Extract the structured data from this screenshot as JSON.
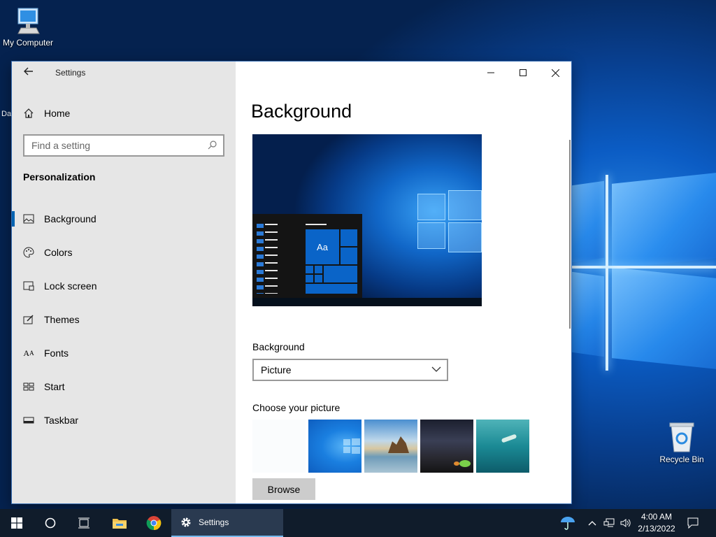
{
  "desktop": {
    "icons": [
      {
        "label": "My Computer"
      },
      {
        "label": "Recycle Bin"
      }
    ],
    "partial_label": "Da"
  },
  "window": {
    "title": "Settings",
    "nav": {
      "home_label": "Home",
      "search_placeholder": "Find a setting",
      "section_label": "Personalization",
      "items": [
        {
          "label": "Background",
          "icon": "picture-icon",
          "active": true
        },
        {
          "label": "Colors",
          "icon": "palette-icon",
          "active": false
        },
        {
          "label": "Lock screen",
          "icon": "lock-screen-icon",
          "active": false
        },
        {
          "label": "Themes",
          "icon": "themes-icon",
          "active": false
        },
        {
          "label": "Fonts",
          "icon": "fonts-icon",
          "active": false
        },
        {
          "label": "Start",
          "icon": "start-icon",
          "active": false
        },
        {
          "label": "Taskbar",
          "icon": "taskbar-icon",
          "active": false
        }
      ]
    },
    "content": {
      "heading": "Background",
      "preview_tile_text": "Aa",
      "background_label": "Background",
      "background_value": "Picture",
      "choose_label": "Choose your picture",
      "browse_label": "Browse"
    }
  },
  "taskbar": {
    "active_app_label": "Settings",
    "time": "4:00 AM",
    "date": "2/13/2022"
  },
  "colors": {
    "accent": "#0063b1",
    "nav_bg": "#e6e6e6",
    "taskbar_bg": "#101c2b"
  }
}
